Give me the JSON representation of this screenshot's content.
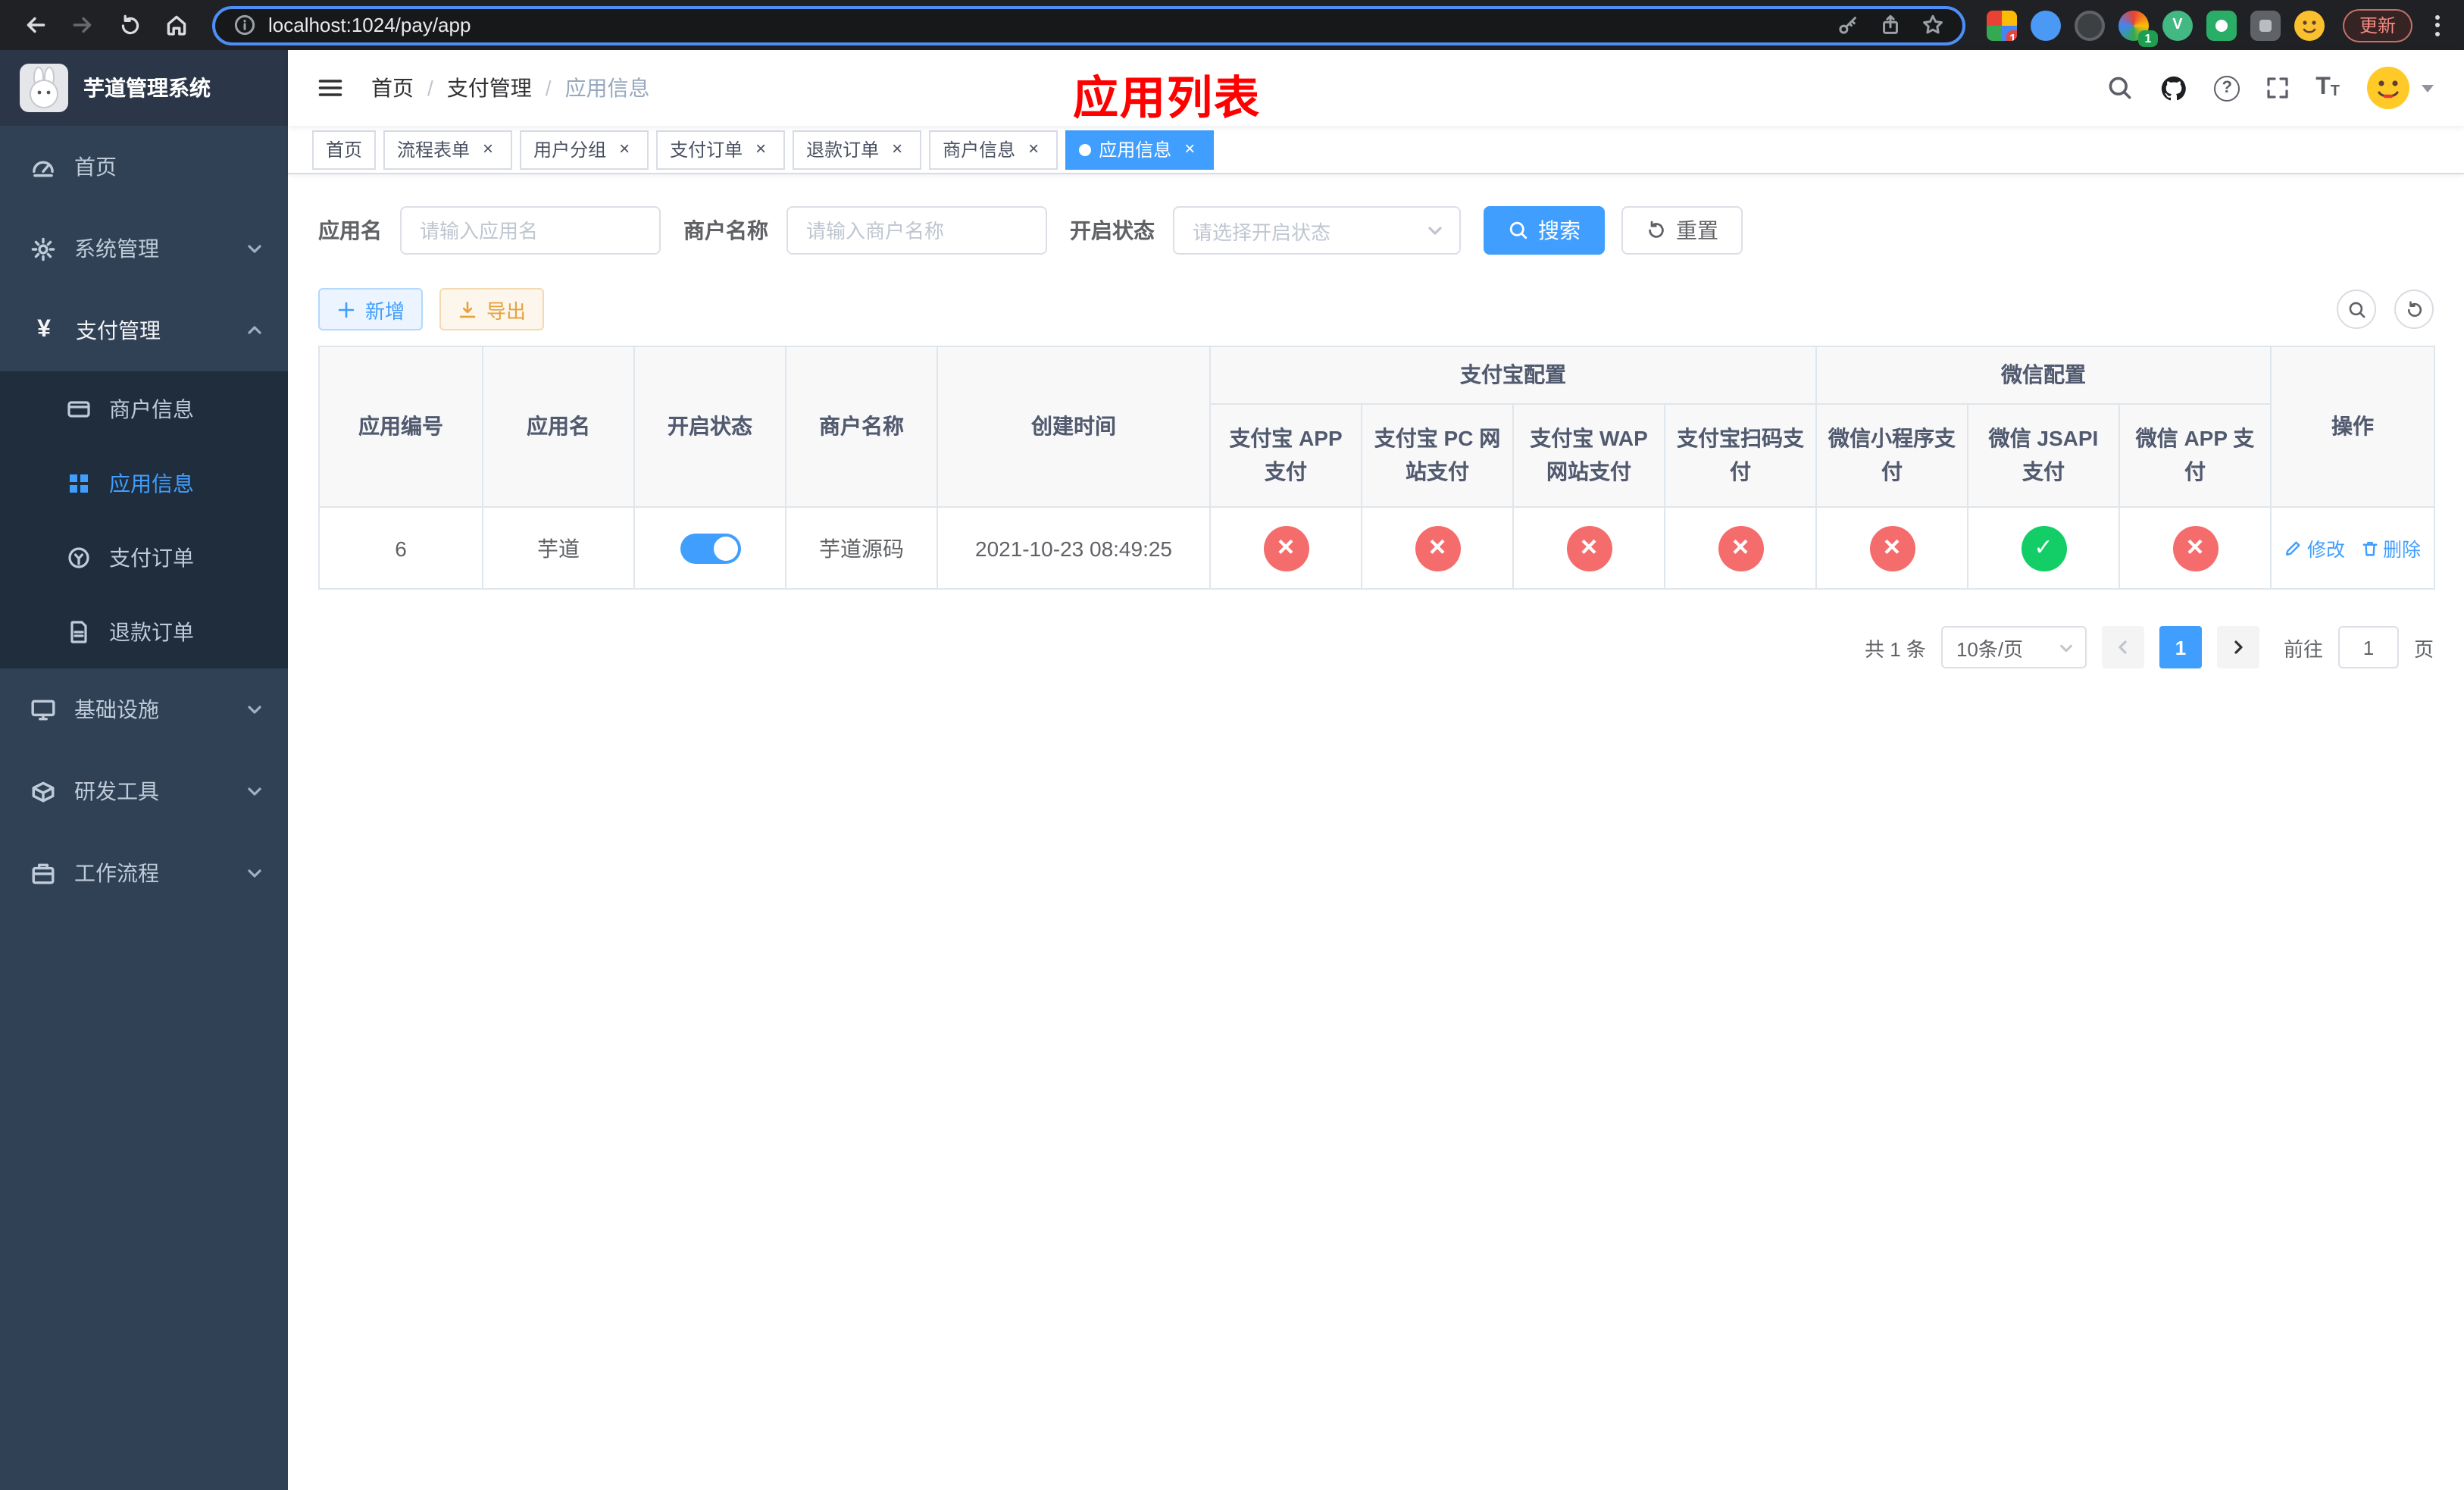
{
  "colors": {
    "primary": "#409eff",
    "success": "#13ce66",
    "danger": "#f56c6c",
    "warning": "#e6a23c",
    "sidebar_bg": "#304156",
    "sidebar_submenu_bg": "#1f2d3d",
    "annotation_red": "#ff0000"
  },
  "icons": {
    "browser": [
      "back",
      "forward",
      "reload",
      "home",
      "info",
      "key",
      "share",
      "star",
      "more-vertical"
    ],
    "navbar": [
      "hamburger",
      "search",
      "github",
      "question-circle",
      "fullscreen",
      "font-size",
      "avatar",
      "caret-down"
    ],
    "status_true": "check-circle",
    "status_false": "cross-circle"
  },
  "browser": {
    "url": "localhost:1024/pay/app",
    "update_button": "更新",
    "extension_badge_1": "10",
    "extension_badge_2": "1"
  },
  "sidebar": {
    "app_title": "芋道管理系统",
    "items": [
      {
        "label": "首页"
      },
      {
        "label": "系统管理"
      },
      {
        "label": "支付管理",
        "expanded": true,
        "children": [
          {
            "label": "商户信息"
          },
          {
            "label": "应用信息",
            "active": true
          },
          {
            "label": "支付订单"
          },
          {
            "label": "退款订单"
          }
        ]
      },
      {
        "label": "基础设施"
      },
      {
        "label": "研发工具"
      },
      {
        "label": "工作流程"
      }
    ]
  },
  "header": {
    "breadcrumb": [
      "首页",
      "支付管理",
      "应用信息"
    ],
    "annotation_title": "应用列表"
  },
  "tabs": [
    {
      "label": "首页",
      "closable": false,
      "active": false
    },
    {
      "label": "流程表单",
      "closable": true,
      "active": false
    },
    {
      "label": "用户分组",
      "closable": true,
      "active": false
    },
    {
      "label": "支付订单",
      "closable": true,
      "active": false
    },
    {
      "label": "退款订单",
      "closable": true,
      "active": false
    },
    {
      "label": "商户信息",
      "closable": true,
      "active": false
    },
    {
      "label": "应用信息",
      "closable": true,
      "active": true
    }
  ],
  "filters": {
    "app_name_label": "应用名",
    "app_name_placeholder": "请输入应用名",
    "merchant_label": "商户名称",
    "merchant_placeholder": "请输入商户名称",
    "status_label": "开启状态",
    "status_placeholder": "请选择开启状态",
    "search_button": "搜索",
    "reset_button": "重置"
  },
  "toolbar": {
    "add_button": "新增",
    "export_button": "导出"
  },
  "table": {
    "headers": {
      "app_id": "应用编号",
      "app_name": "应用名",
      "status": "开启状态",
      "merchant": "商户名称",
      "created": "创建时间",
      "alipay_group": "支付宝配置",
      "alipay_app": "支付宝 APP 支付",
      "alipay_pc": "支付宝 PC 网站支付",
      "alipay_wap": "支付宝 WAP 网站支付",
      "alipay_qr": "支付宝扫码支付",
      "wechat_group": "微信配置",
      "wechat_lite": "微信小程序支付",
      "wechat_jsapi": "微信 JSAPI 支付",
      "wechat_app": "微信 APP 支付",
      "actions": "操作"
    },
    "rows": [
      {
        "id": "6",
        "name": "芋道",
        "enabled": true,
        "merchant": "芋道源码",
        "created": "2021-10-23 08:49:25",
        "alipay_app": false,
        "alipay_pc": false,
        "alipay_wap": false,
        "alipay_qr": false,
        "wechat_lite": false,
        "wechat_jsapi": true,
        "wechat_app": false,
        "edit_label": "修改",
        "delete_label": "删除"
      }
    ]
  },
  "pagination": {
    "total_text": "共 1 条",
    "page_size": "10条/页",
    "current_page": "1",
    "goto_label": "前往",
    "goto_value": "1",
    "page_unit": "页"
  }
}
